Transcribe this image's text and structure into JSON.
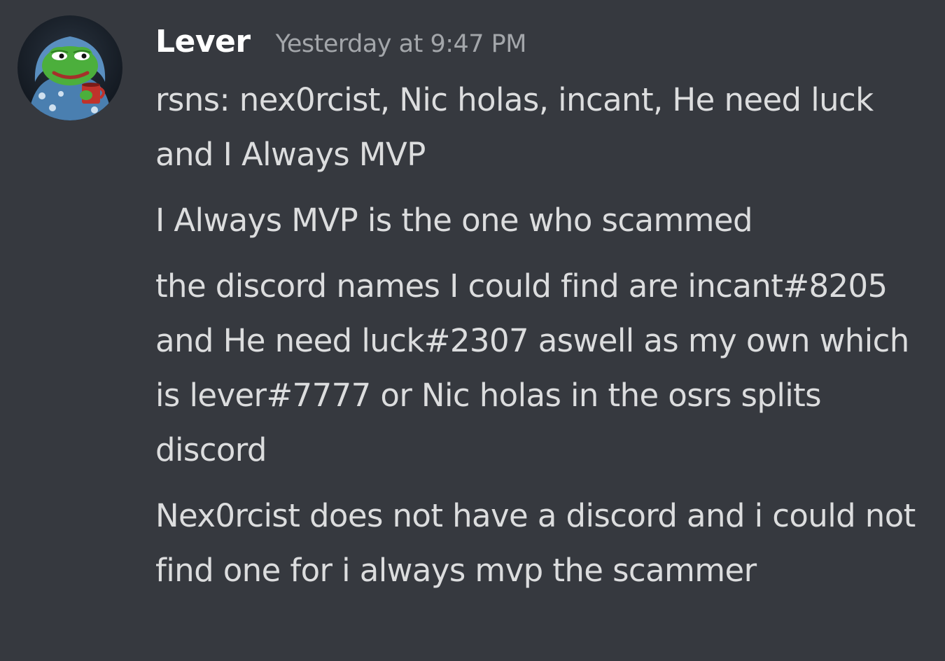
{
  "author": {
    "username": "Lever",
    "timestamp": "Yesterday at 9:47 PM",
    "avatar_icon": "pepe-frog-bathrobe-avatar-icon"
  },
  "messages": [
    {
      "text": "rsns: nex0rcist, Nic holas, incant, He need luck and I Always MVP"
    },
    {
      "text": "I Always MVP is the one who scammed"
    },
    {
      "text": "the discord names I could find are incant#8205 and He need luck#2307 aswell as my own which is lever#7777 or Nic holas in the osrs splits discord"
    },
    {
      "text": "Nex0rcist does not have a discord and i could not find one for i always mvp the scammer"
    }
  ],
  "colors": {
    "background": "#36393f",
    "username": "#ffffff",
    "timestamp": "#a3a6aa",
    "message_text": "#dcddde"
  }
}
